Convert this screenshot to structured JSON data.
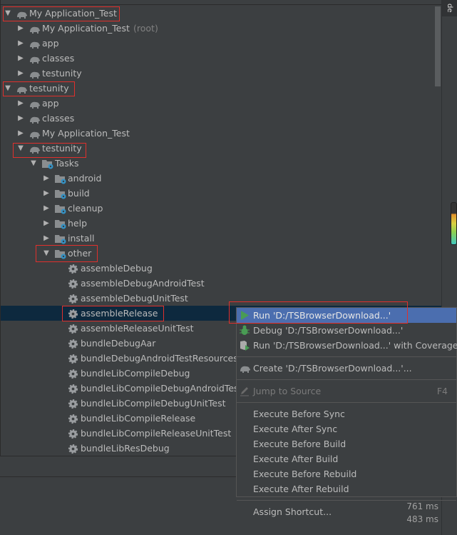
{
  "tree": [
    {
      "label": "My Application_Test",
      "level": 0,
      "arrow": "down",
      "icon": "gradle-elephant-icon"
    },
    {
      "label": "My Application_Test",
      "suffix": "(root)",
      "level": 1,
      "arrow": "right",
      "icon": "gradle-elephant-icon"
    },
    {
      "label": "app",
      "level": 1,
      "arrow": "right",
      "icon": "gradle-elephant-icon"
    },
    {
      "label": "classes",
      "level": 1,
      "arrow": "right",
      "icon": "gradle-elephant-icon"
    },
    {
      "label": "testunity",
      "level": 1,
      "arrow": "right",
      "icon": "gradle-elephant-icon"
    },
    {
      "label": "testunity",
      "level": 0,
      "arrow": "down",
      "icon": "gradle-elephant-icon"
    },
    {
      "label": "app",
      "level": 1,
      "arrow": "right",
      "icon": "gradle-elephant-icon"
    },
    {
      "label": "classes",
      "level": 1,
      "arrow": "right",
      "icon": "gradle-elephant-icon"
    },
    {
      "label": "My Application_Test",
      "level": 1,
      "arrow": "right",
      "icon": "gradle-elephant-icon"
    },
    {
      "label": "testunity",
      "level": 1,
      "arrow": "down",
      "icon": "gradle-elephant-icon"
    },
    {
      "label": "Tasks",
      "level": 2,
      "arrow": "down",
      "icon": "task-folder-icon"
    },
    {
      "label": "android",
      "level": 3,
      "arrow": "right",
      "icon": "task-folder-icon"
    },
    {
      "label": "build",
      "level": 3,
      "arrow": "right",
      "icon": "task-folder-icon"
    },
    {
      "label": "cleanup",
      "level": 3,
      "arrow": "right",
      "icon": "task-folder-icon"
    },
    {
      "label": "help",
      "level": 3,
      "arrow": "right",
      "icon": "task-folder-icon"
    },
    {
      "label": "install",
      "level": 3,
      "arrow": "right",
      "icon": "task-folder-icon"
    },
    {
      "label": "other",
      "level": 3,
      "arrow": "down",
      "icon": "task-folder-icon"
    },
    {
      "label": "assembleDebug",
      "level": 4,
      "icon": "gear-icon"
    },
    {
      "label": "assembleDebugAndroidTest",
      "level": 4,
      "icon": "gear-icon"
    },
    {
      "label": "assembleDebugUnitTest",
      "level": 4,
      "icon": "gear-icon"
    },
    {
      "label": "assembleRelease",
      "level": 4,
      "icon": "gear-icon",
      "selected": true
    },
    {
      "label": "assembleReleaseUnitTest",
      "level": 4,
      "icon": "gear-icon"
    },
    {
      "label": "bundleDebugAar",
      "level": 4,
      "icon": "gear-icon"
    },
    {
      "label": "bundleDebugAndroidTestResources",
      "level": 4,
      "icon": "gear-icon"
    },
    {
      "label": "bundleLibCompileDebug",
      "level": 4,
      "icon": "gear-icon"
    },
    {
      "label": "bundleLibCompileDebugAndroidTest",
      "level": 4,
      "icon": "gear-icon"
    },
    {
      "label": "bundleLibCompileDebugUnitTest",
      "level": 4,
      "icon": "gear-icon"
    },
    {
      "label": "bundleLibCompileRelease",
      "level": 4,
      "icon": "gear-icon"
    },
    {
      "label": "bundleLibCompileReleaseUnitTest",
      "level": 4,
      "icon": "gear-icon"
    },
    {
      "label": "bundleLibResDebug",
      "level": 4,
      "icon": "gear-icon"
    }
  ],
  "side_tab": "de",
  "timings": [
    "761 ms",
    "483 ms"
  ],
  "context_menu": {
    "items": [
      {
        "label": "Run 'D:/TSBrowserDownload...'",
        "icon": "run-icon",
        "highlighted": true
      },
      {
        "label": "Debug 'D:/TSBrowserDownload...'",
        "icon": "debug-bug-icon"
      },
      {
        "label": "Run 'D:/TSBrowserDownload...' with Coverage",
        "icon": "coverage-icon"
      },
      {
        "separator": true
      },
      {
        "label": "Create 'D:/TSBrowserDownload...'...",
        "icon": "gradle-elephant-icon"
      },
      {
        "separator": true
      },
      {
        "label": "Jump to Source",
        "icon": "pencil-icon",
        "shortcut": "F4",
        "disabled": true
      },
      {
        "separator": true
      },
      {
        "label": "Execute Before Sync"
      },
      {
        "label": "Execute After Sync"
      },
      {
        "label": "Execute Before Build"
      },
      {
        "label": "Execute After Build"
      },
      {
        "label": "Execute Before Rebuild"
      },
      {
        "label": "Execute After Rebuild"
      },
      {
        "separator": true
      },
      {
        "label": "Assign Shortcut..."
      }
    ]
  },
  "colors": {
    "background": "#3c3f41",
    "selection": "#0d293e",
    "menu_highlight": "#4b6eaf",
    "annotation_red": "#e0302c",
    "run_green": "#499c54",
    "task_blue": "#3592c4"
  }
}
